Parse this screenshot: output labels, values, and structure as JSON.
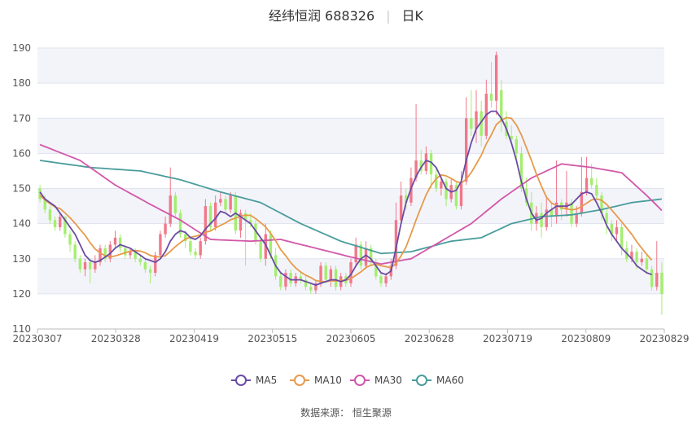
{
  "header": {
    "stock": "经纬恒润 688326",
    "period": "日K"
  },
  "source": "数据来源： 恒生聚源",
  "colors": {
    "up": "#f0788a",
    "down": "#a4ee6f",
    "ma5": "#6a4ba3",
    "ma10": "#e69a4a",
    "ma30": "#d257a9",
    "ma60": "#4a9c9c",
    "band": "#f3f4fa",
    "grid": "#dfe3ee"
  },
  "chart_data": {
    "type": "candlestick",
    "ylim": [
      110,
      190
    ],
    "yticks": [
      110,
      120,
      130,
      140,
      150,
      160,
      170,
      180,
      190
    ],
    "xticks": [
      "20230307",
      "20230328",
      "20230419",
      "20230515",
      "20230605",
      "20230628",
      "20230719",
      "20230809",
      "20230829"
    ],
    "legend_position": "bottom",
    "series_names": [
      "MA5",
      "MA10",
      "MA30",
      "MA60"
    ],
    "candles": [
      [
        150,
        147,
        151,
        146
      ],
      [
        147,
        144,
        148,
        143
      ],
      [
        144,
        141,
        145,
        140
      ],
      [
        141,
        139,
        142,
        138
      ],
      [
        139,
        142,
        143,
        138
      ],
      [
        142,
        137,
        142,
        136
      ],
      [
        137,
        134,
        138,
        132
      ],
      [
        134,
        130,
        135,
        129
      ],
      [
        130,
        127,
        131,
        126
      ],
      [
        127,
        129,
        130,
        125
      ],
      [
        129,
        127,
        130,
        123
      ],
      [
        127,
        129,
        131,
        126
      ],
      [
        129,
        133,
        134,
        128
      ],
      [
        133,
        130,
        134,
        129
      ],
      [
        130,
        134,
        135,
        129
      ],
      [
        134,
        136,
        138,
        133
      ],
      [
        136,
        133,
        137,
        132
      ],
      [
        133,
        131,
        134,
        130
      ],
      [
        131,
        132,
        133,
        130
      ],
      [
        132,
        130,
        133,
        129
      ],
      [
        130,
        129,
        131,
        128
      ],
      [
        129,
        127,
        130,
        126
      ],
      [
        127,
        126,
        128,
        123
      ],
      [
        126,
        131,
        132,
        125
      ],
      [
        131,
        137,
        138,
        130
      ],
      [
        137,
        140,
        142,
        136
      ],
      [
        140,
        148,
        156,
        139
      ],
      [
        148,
        143,
        149,
        142
      ],
      [
        143,
        137,
        144,
        136
      ],
      [
        137,
        135,
        138,
        133
      ],
      [
        135,
        132,
        136,
        131
      ],
      [
        132,
        131,
        133,
        130
      ],
      [
        131,
        135,
        136,
        130
      ],
      [
        135,
        145,
        147,
        134
      ],
      [
        145,
        139,
        146,
        138
      ],
      [
        139,
        146,
        148,
        138
      ],
      [
        146,
        147,
        149,
        145
      ],
      [
        147,
        144,
        148,
        143
      ],
      [
        144,
        148,
        149,
        143
      ],
      [
        148,
        138,
        149,
        137
      ],
      [
        138,
        143,
        144,
        136
      ],
      [
        143,
        141,
        144,
        128
      ],
      [
        141,
        140,
        143,
        139
      ],
      [
        140,
        135,
        141,
        134
      ],
      [
        135,
        130,
        136,
        129
      ],
      [
        130,
        137,
        140,
        128
      ],
      [
        137,
        131,
        138,
        130
      ],
      [
        131,
        125,
        133,
        124
      ],
      [
        125,
        122,
        126,
        121
      ],
      [
        122,
        126,
        127,
        121
      ],
      [
        126,
        123,
        127,
        122
      ],
      [
        123,
        125,
        126,
        122
      ],
      [
        125,
        124,
        126,
        123
      ],
      [
        124,
        122,
        125,
        121
      ],
      [
        122,
        121,
        123,
        120
      ],
      [
        121,
        123,
        124,
        120
      ],
      [
        123,
        128,
        129,
        122
      ],
      [
        128,
        124,
        129,
        123
      ],
      [
        124,
        127,
        128,
        122
      ],
      [
        127,
        122,
        128,
        121
      ],
      [
        122,
        125,
        126,
        121
      ],
      [
        125,
        123,
        126,
        122
      ],
      [
        123,
        129,
        130,
        122
      ],
      [
        129,
        134,
        136,
        128
      ],
      [
        134,
        128,
        135,
        127
      ],
      [
        128,
        133,
        135,
        127
      ],
      [
        133,
        129,
        134,
        128
      ],
      [
        129,
        125,
        130,
        124
      ],
      [
        125,
        123,
        126,
        122
      ],
      [
        123,
        125,
        126,
        122
      ],
      [
        125,
        128,
        130,
        124
      ],
      [
        128,
        141,
        146,
        127
      ],
      [
        141,
        148,
        152,
        140
      ],
      [
        148,
        146,
        150,
        144
      ],
      [
        146,
        153,
        156,
        145
      ],
      [
        153,
        158,
        174,
        152
      ],
      [
        158,
        155,
        161,
        154
      ],
      [
        155,
        160,
        162,
        154
      ],
      [
        160,
        154,
        161,
        150
      ],
      [
        154,
        150,
        156,
        149
      ],
      [
        150,
        152,
        154,
        148
      ],
      [
        152,
        147,
        153,
        145
      ],
      [
        147,
        151,
        153,
        146
      ],
      [
        151,
        145,
        152,
        144
      ],
      [
        145,
        152,
        155,
        144
      ],
      [
        152,
        170,
        176,
        151
      ],
      [
        170,
        167,
        178,
        165
      ],
      [
        167,
        172,
        178,
        163
      ],
      [
        172,
        165,
        175,
        162
      ],
      [
        165,
        177,
        181,
        164
      ],
      [
        177,
        175,
        186,
        173
      ],
      [
        175,
        188,
        189,
        171
      ],
      [
        178,
        169,
        181,
        166
      ],
      [
        169,
        165,
        172,
        164
      ],
      [
        165,
        164,
        168,
        163
      ],
      [
        164,
        160,
        165,
        158
      ],
      [
        160,
        150,
        162,
        149
      ],
      [
        150,
        146,
        153,
        145
      ],
      [
        146,
        140,
        149,
        138
      ],
      [
        140,
        143,
        145,
        138
      ],
      [
        143,
        139,
        146,
        136
      ],
      [
        139,
        144,
        148,
        138
      ],
      [
        144,
        142,
        146,
        139
      ],
      [
        142,
        146,
        158,
        140
      ],
      [
        146,
        144,
        147,
        141
      ],
      [
        144,
        146,
        155,
        142
      ],
      [
        146,
        140,
        147,
        139
      ],
      [
        140,
        143,
        145,
        139
      ],
      [
        143,
        149,
        159,
        142
      ],
      [
        149,
        153,
        159,
        148
      ],
      [
        153,
        151,
        157,
        150
      ],
      [
        151,
        148,
        153,
        147
      ],
      [
        148,
        143,
        149,
        141
      ],
      [
        143,
        140,
        144,
        137
      ],
      [
        140,
        137,
        141,
        135
      ],
      [
        137,
        139,
        141,
        135
      ],
      [
        139,
        133,
        140,
        131
      ],
      [
        133,
        130,
        135,
        129
      ],
      [
        130,
        132,
        134,
        129
      ],
      [
        132,
        129,
        133,
        127
      ],
      [
        129,
        130,
        132,
        128
      ],
      [
        130,
        127,
        131,
        126
      ],
      [
        127,
        122,
        128,
        121
      ],
      [
        122,
        126,
        135,
        121
      ],
      [
        126,
        120,
        129,
        114
      ]
    ],
    "ma5": [
      149,
      147,
      146,
      145,
      143,
      141,
      139,
      137,
      134,
      131,
      129.5,
      129,
      129.5,
      130.5,
      131.5,
      133,
      134,
      133.5,
      133,
      132,
      131,
      130,
      129.5,
      129,
      130,
      132,
      135,
      137,
      138,
      137.5,
      136,
      135.5,
      136.5,
      138.5,
      140,
      141.5,
      143.5,
      143,
      142,
      143,
      142,
      141,
      140,
      138,
      136,
      134,
      131,
      128,
      126,
      125,
      124,
      124,
      124,
      123.5,
      123,
      122.5,
      123,
      123.5,
      124,
      124,
      123.5,
      124,
      125.5,
      128,
      130,
      131,
      130,
      128,
      126,
      125.5,
      126.5,
      133,
      140,
      146,
      150,
      153.5,
      156,
      158,
      157.5,
      156,
      153,
      150,
      149,
      149.5,
      152,
      158,
      163,
      167,
      169,
      171,
      172,
      172,
      170,
      167,
      163,
      158,
      152,
      147,
      143,
      141,
      141.5,
      143,
      144,
      145,
      145,
      145,
      145.5,
      147,
      148.5,
      149,
      148.5,
      146,
      143,
      139.5,
      137,
      135,
      133,
      131.5,
      130,
      128,
      127,
      126,
      125.5
    ]
  }
}
